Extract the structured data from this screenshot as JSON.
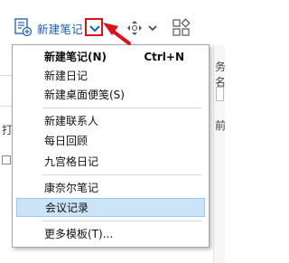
{
  "toolbar": {
    "new_note_label": "新建笔记",
    "icons": [
      "new-note-icon",
      "dropdown-arrow-icon",
      "navigation-icon",
      "layout-grid-icon"
    ]
  },
  "background_fragments": {
    "top_right": "务名",
    "row2": "打",
    "row3": "前"
  },
  "menu": {
    "items": [
      {
        "label": "新建笔记(N)",
        "shortcut": "Ctrl+N",
        "bold": true
      },
      {
        "label": "新建日记"
      },
      {
        "label": "新建桌面便笺(S)"
      },
      {
        "label": "新建联系人"
      },
      {
        "label": "每日回顾"
      },
      {
        "label": "九宫格日记"
      },
      {
        "label": "康奈尔笔记"
      },
      {
        "label": "会议记录",
        "selected": true
      },
      {
        "label": "更多模板(T)..."
      }
    ]
  },
  "colors": {
    "accent_blue": "#1a5fb4",
    "highlight_red": "#e0101b",
    "selection_bg": "#cce4f7",
    "selection_border": "#99c9ef"
  }
}
